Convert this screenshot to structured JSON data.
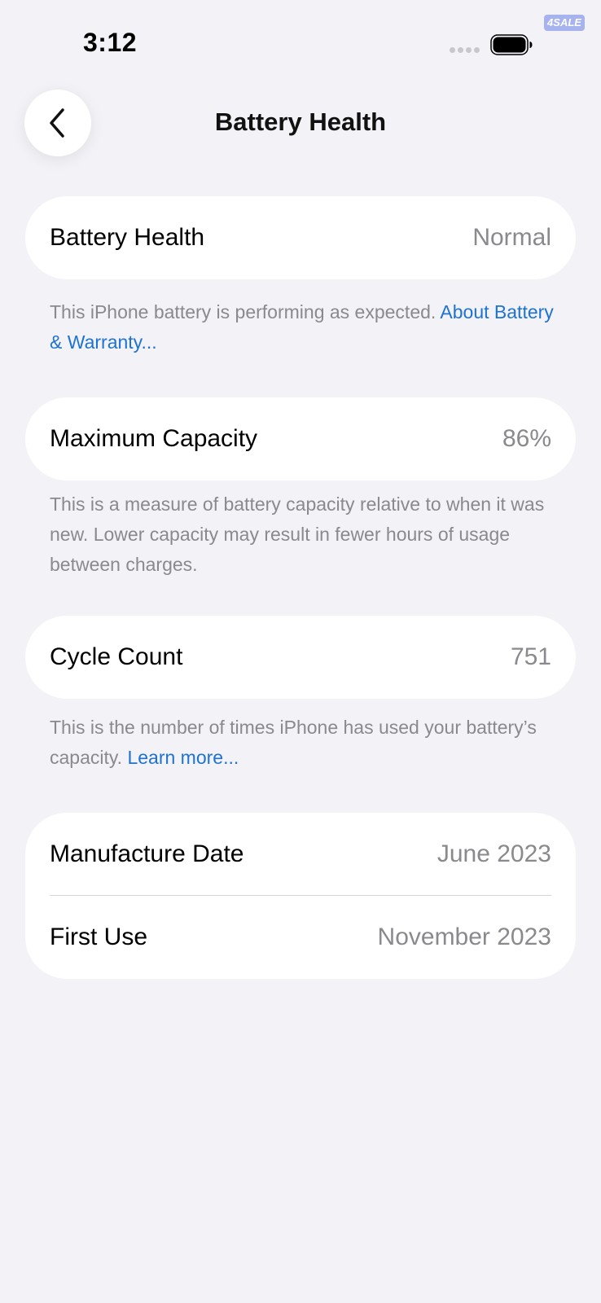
{
  "status_bar": {
    "time": "3:12",
    "watermark": "4SALE"
  },
  "nav": {
    "title": "Battery Health",
    "back_icon": "chevron-left-icon"
  },
  "battery_health": {
    "label": "Battery Health",
    "value": "Normal",
    "footnote_text": "This iPhone battery is performing as expected. ",
    "footnote_link": "About Battery & Warranty..."
  },
  "maximum_capacity": {
    "label": "Maximum Capacity",
    "value": "86%",
    "footnote_text": "This is a measure of battery capacity relative to when it was new. Lower capacity may result in fewer hours of usage between charges."
  },
  "cycle_count": {
    "label": "Cycle Count",
    "value": "751",
    "footnote_text": "This is the number of times iPhone has used your battery’s capacity. ",
    "footnote_link": "Learn more..."
  },
  "dates": {
    "manufacture_label": "Manufacture Date",
    "manufacture_value": "June 2023",
    "first_use_label": "First Use",
    "first_use_value": "November 2023"
  },
  "colors": {
    "background": "#f2f2f7",
    "card": "#ffffff",
    "link": "#1e73d2",
    "secondary_text": "#8a8a8e"
  }
}
